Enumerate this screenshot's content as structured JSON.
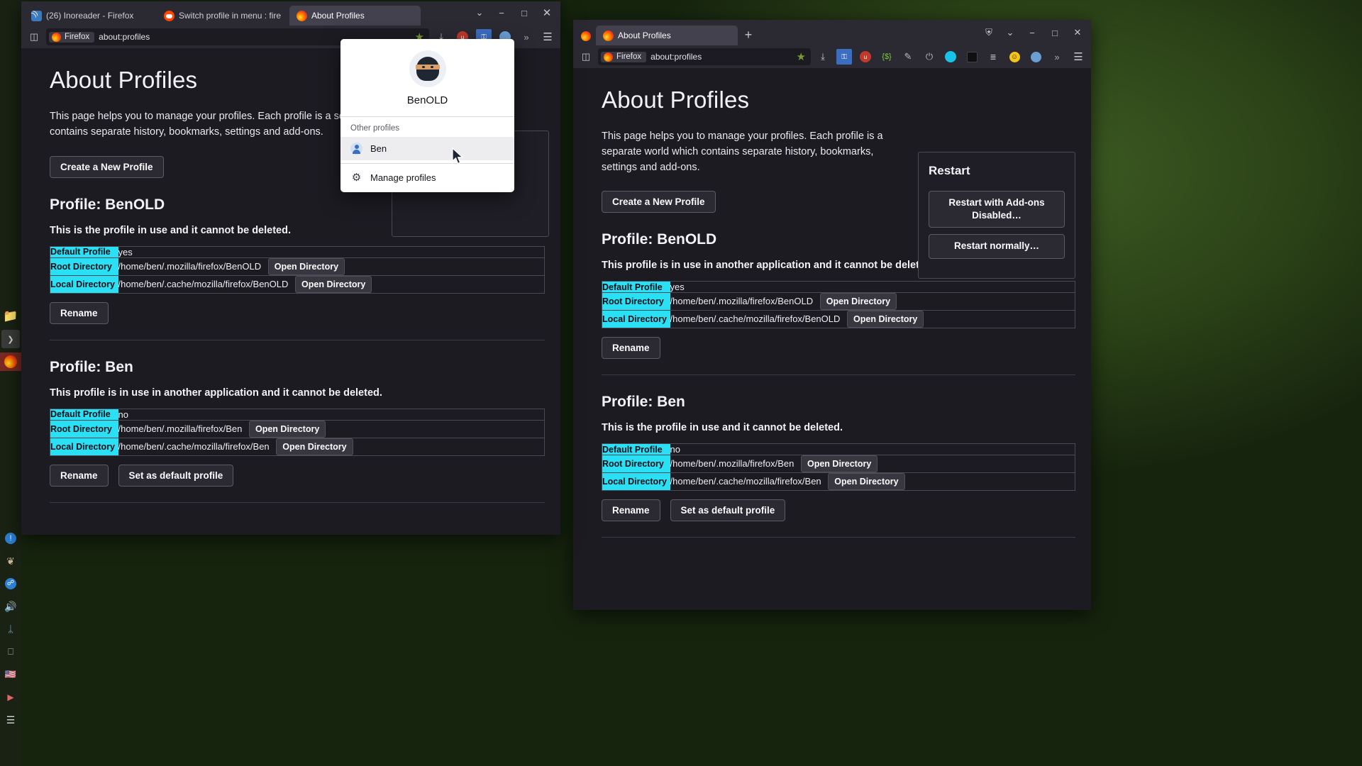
{
  "taskbar": {
    "items": [
      {
        "name": "files-icon",
        "glyph": "📁"
      },
      {
        "name": "terminal-icon",
        "glyph": "❯"
      },
      {
        "name": "firefox-icon",
        "glyph": "●"
      },
      {
        "name": "info-icon",
        "glyph": "!"
      },
      {
        "name": "feather-icon",
        "glyph": "❯"
      },
      {
        "name": "bluetooth-icon",
        "glyph": "ᛦ"
      },
      {
        "name": "display-icon",
        "glyph": "▭"
      },
      {
        "name": "flag-icon",
        "glyph": "⚑"
      },
      {
        "name": "play-icon",
        "glyph": "▶"
      },
      {
        "name": "menu-icon",
        "glyph": "☰"
      }
    ]
  },
  "left_window": {
    "tabs": [
      {
        "label": "(26) Inoreader - Firefox",
        "favicon": "inoreader-favicon",
        "active": false
      },
      {
        "label": "Switch profile in menu : firefo",
        "favicon": "reddit-favicon",
        "active": false
      },
      {
        "label": "About Profiles",
        "favicon": "firefox-favicon",
        "active": true
      }
    ],
    "tabstrip_buttons": [
      {
        "name": "list-all-tabs-button",
        "glyph": "⌄"
      },
      {
        "name": "minimize-button",
        "glyph": "−"
      },
      {
        "name": "maximize-button",
        "glyph": "□"
      },
      {
        "name": "close-window-button",
        "glyph": "✕"
      }
    ],
    "navbar": {
      "sidebar_button": "sidebar-icon",
      "profile_chip": "Firefox",
      "url": "about:profiles",
      "bookmark_star": "star-icon",
      "extensions": [
        {
          "name": "downloads-icon",
          "glyph": "⤓",
          "class": "e-dl"
        },
        {
          "name": "ublock-origin-icon",
          "glyph": "u",
          "class": "e-red"
        },
        {
          "name": "shield-icon",
          "glyph": "⬟",
          "class": "e-ubo"
        },
        {
          "name": "account-icon",
          "glyph": "●",
          "class": "e-acct"
        },
        {
          "name": "overflow-chevrons-icon",
          "glyph": "»",
          "class": "e-chev"
        },
        {
          "name": "app-menu-icon",
          "glyph": "☰",
          "class": "e-menu"
        }
      ]
    }
  },
  "right_window": {
    "tabs": [
      {
        "label": "About Profiles",
        "favicon": "firefox-favicon",
        "active": true
      }
    ],
    "new_tab_glyph": "+",
    "tabstrip_buttons": [
      {
        "name": "shield-tracking-button",
        "glyph": "⛨"
      },
      {
        "name": "list-all-tabs-button",
        "glyph": "⌄"
      },
      {
        "name": "minimize-button",
        "glyph": "−"
      },
      {
        "name": "maximize-button",
        "glyph": "□"
      },
      {
        "name": "close-window-button",
        "glyph": "✕"
      }
    ],
    "navbar": {
      "sidebar_button": "sidebar-icon",
      "profile_chip": "Firefox",
      "url": "about:profiles",
      "bookmark_star": "star-icon",
      "extensions": [
        {
          "name": "downloads-icon",
          "glyph": "⤓",
          "class": "e-dl"
        },
        {
          "name": "shield-icon",
          "glyph": "⬟",
          "class": "e-ubo"
        },
        {
          "name": "ublock-origin-icon",
          "glyph": "u",
          "class": "e-red"
        },
        {
          "name": "script-blocker-icon",
          "glyph": "{$}",
          "class": "e-grn"
        },
        {
          "name": "eyedropper-icon",
          "glyph": "✒",
          "class": "e-pen"
        },
        {
          "name": "power-toggle-icon",
          "glyph": "⏻",
          "class": "e-pwr"
        },
        {
          "name": "chat-bubble-icon",
          "glyph": "▬",
          "class": "e-cyan"
        },
        {
          "name": "reader-icon",
          "glyph": "◧",
          "class": "e-blk"
        },
        {
          "name": "list-icon",
          "glyph": "≣",
          "class": "e-list"
        },
        {
          "name": "emoji-icon",
          "glyph": "☺",
          "class": "e-smile"
        },
        {
          "name": "account-icon",
          "glyph": "●",
          "class": "e-acct"
        },
        {
          "name": "overflow-chevrons-icon",
          "glyph": "»",
          "class": "e-chev"
        },
        {
          "name": "app-menu-icon",
          "glyph": "☰",
          "class": "e-menu"
        }
      ]
    },
    "restart_card": {
      "heading": "Restart",
      "addons_disabled_label": "Restart with Add-ons Disabled…",
      "normally_label": "Restart normally…"
    }
  },
  "page": {
    "title": "About Profiles",
    "description": "This page helps you to manage your profiles. Each profile is a separate world which contains separate history, bookmarks, settings and add-ons.",
    "create_button": "Create a New Profile",
    "table_headers": {
      "default_profile": "Default Profile",
      "root_directory": "Root Directory",
      "local_directory": "Local Directory"
    },
    "open_directory_label": "Open Directory",
    "rename_label": "Rename",
    "set_default_label": "Set as default profile",
    "status_in_use": "This is the profile in use and it cannot be deleted.",
    "status_other_app": "This profile is in use in another application and it cannot be deleted."
  },
  "left_profiles": [
    {
      "heading": "Profile: BenOLD",
      "status": "This is the profile in use and it cannot be deleted.",
      "default_profile": "yes",
      "root_directory": "/home/ben/.mozilla/firefox/BenOLD",
      "local_directory": "/home/ben/.cache/mozilla/firefox/BenOLD",
      "has_set_default": false
    },
    {
      "heading": "Profile: Ben",
      "status": "This profile is in use in another application and it cannot be deleted.",
      "default_profile": "no",
      "root_directory": "/home/ben/.mozilla/firefox/Ben",
      "local_directory": "/home/ben/.cache/mozilla/firefox/Ben",
      "has_set_default": true
    }
  ],
  "right_profiles": [
    {
      "heading": "Profile: BenOLD",
      "status": "This profile is in use in another application and it cannot be deleted.",
      "default_profile": "yes",
      "root_directory": "/home/ben/.mozilla/firefox/BenOLD",
      "local_directory": "/home/ben/.cache/mozilla/firefox/BenOLD",
      "has_set_default": false
    },
    {
      "heading": "Profile: Ben",
      "status": "This is the profile in use and it cannot be deleted.",
      "default_profile": "no",
      "root_directory": "/home/ben/.mozilla/firefox/Ben",
      "local_directory": "/home/ben/.cache/mozilla/firefox/Ben",
      "has_set_default": true
    }
  ],
  "profile_popup": {
    "current_profile_name": "BenOLD",
    "avatar": "ninja-avatar-icon",
    "other_profiles_label": "Other profiles",
    "items": [
      {
        "label": "Ben",
        "icon": "profile-avatar-icon",
        "hovered": true
      },
      {
        "label": "Manage profiles",
        "icon": "gear-icon",
        "hovered": false
      }
    ]
  },
  "colors": {
    "accent_cyan": "#2ae0f5",
    "chrome_bg": "#2b2a33",
    "page_bg": "#1c1b22",
    "star_green": "#7a9a33"
  }
}
